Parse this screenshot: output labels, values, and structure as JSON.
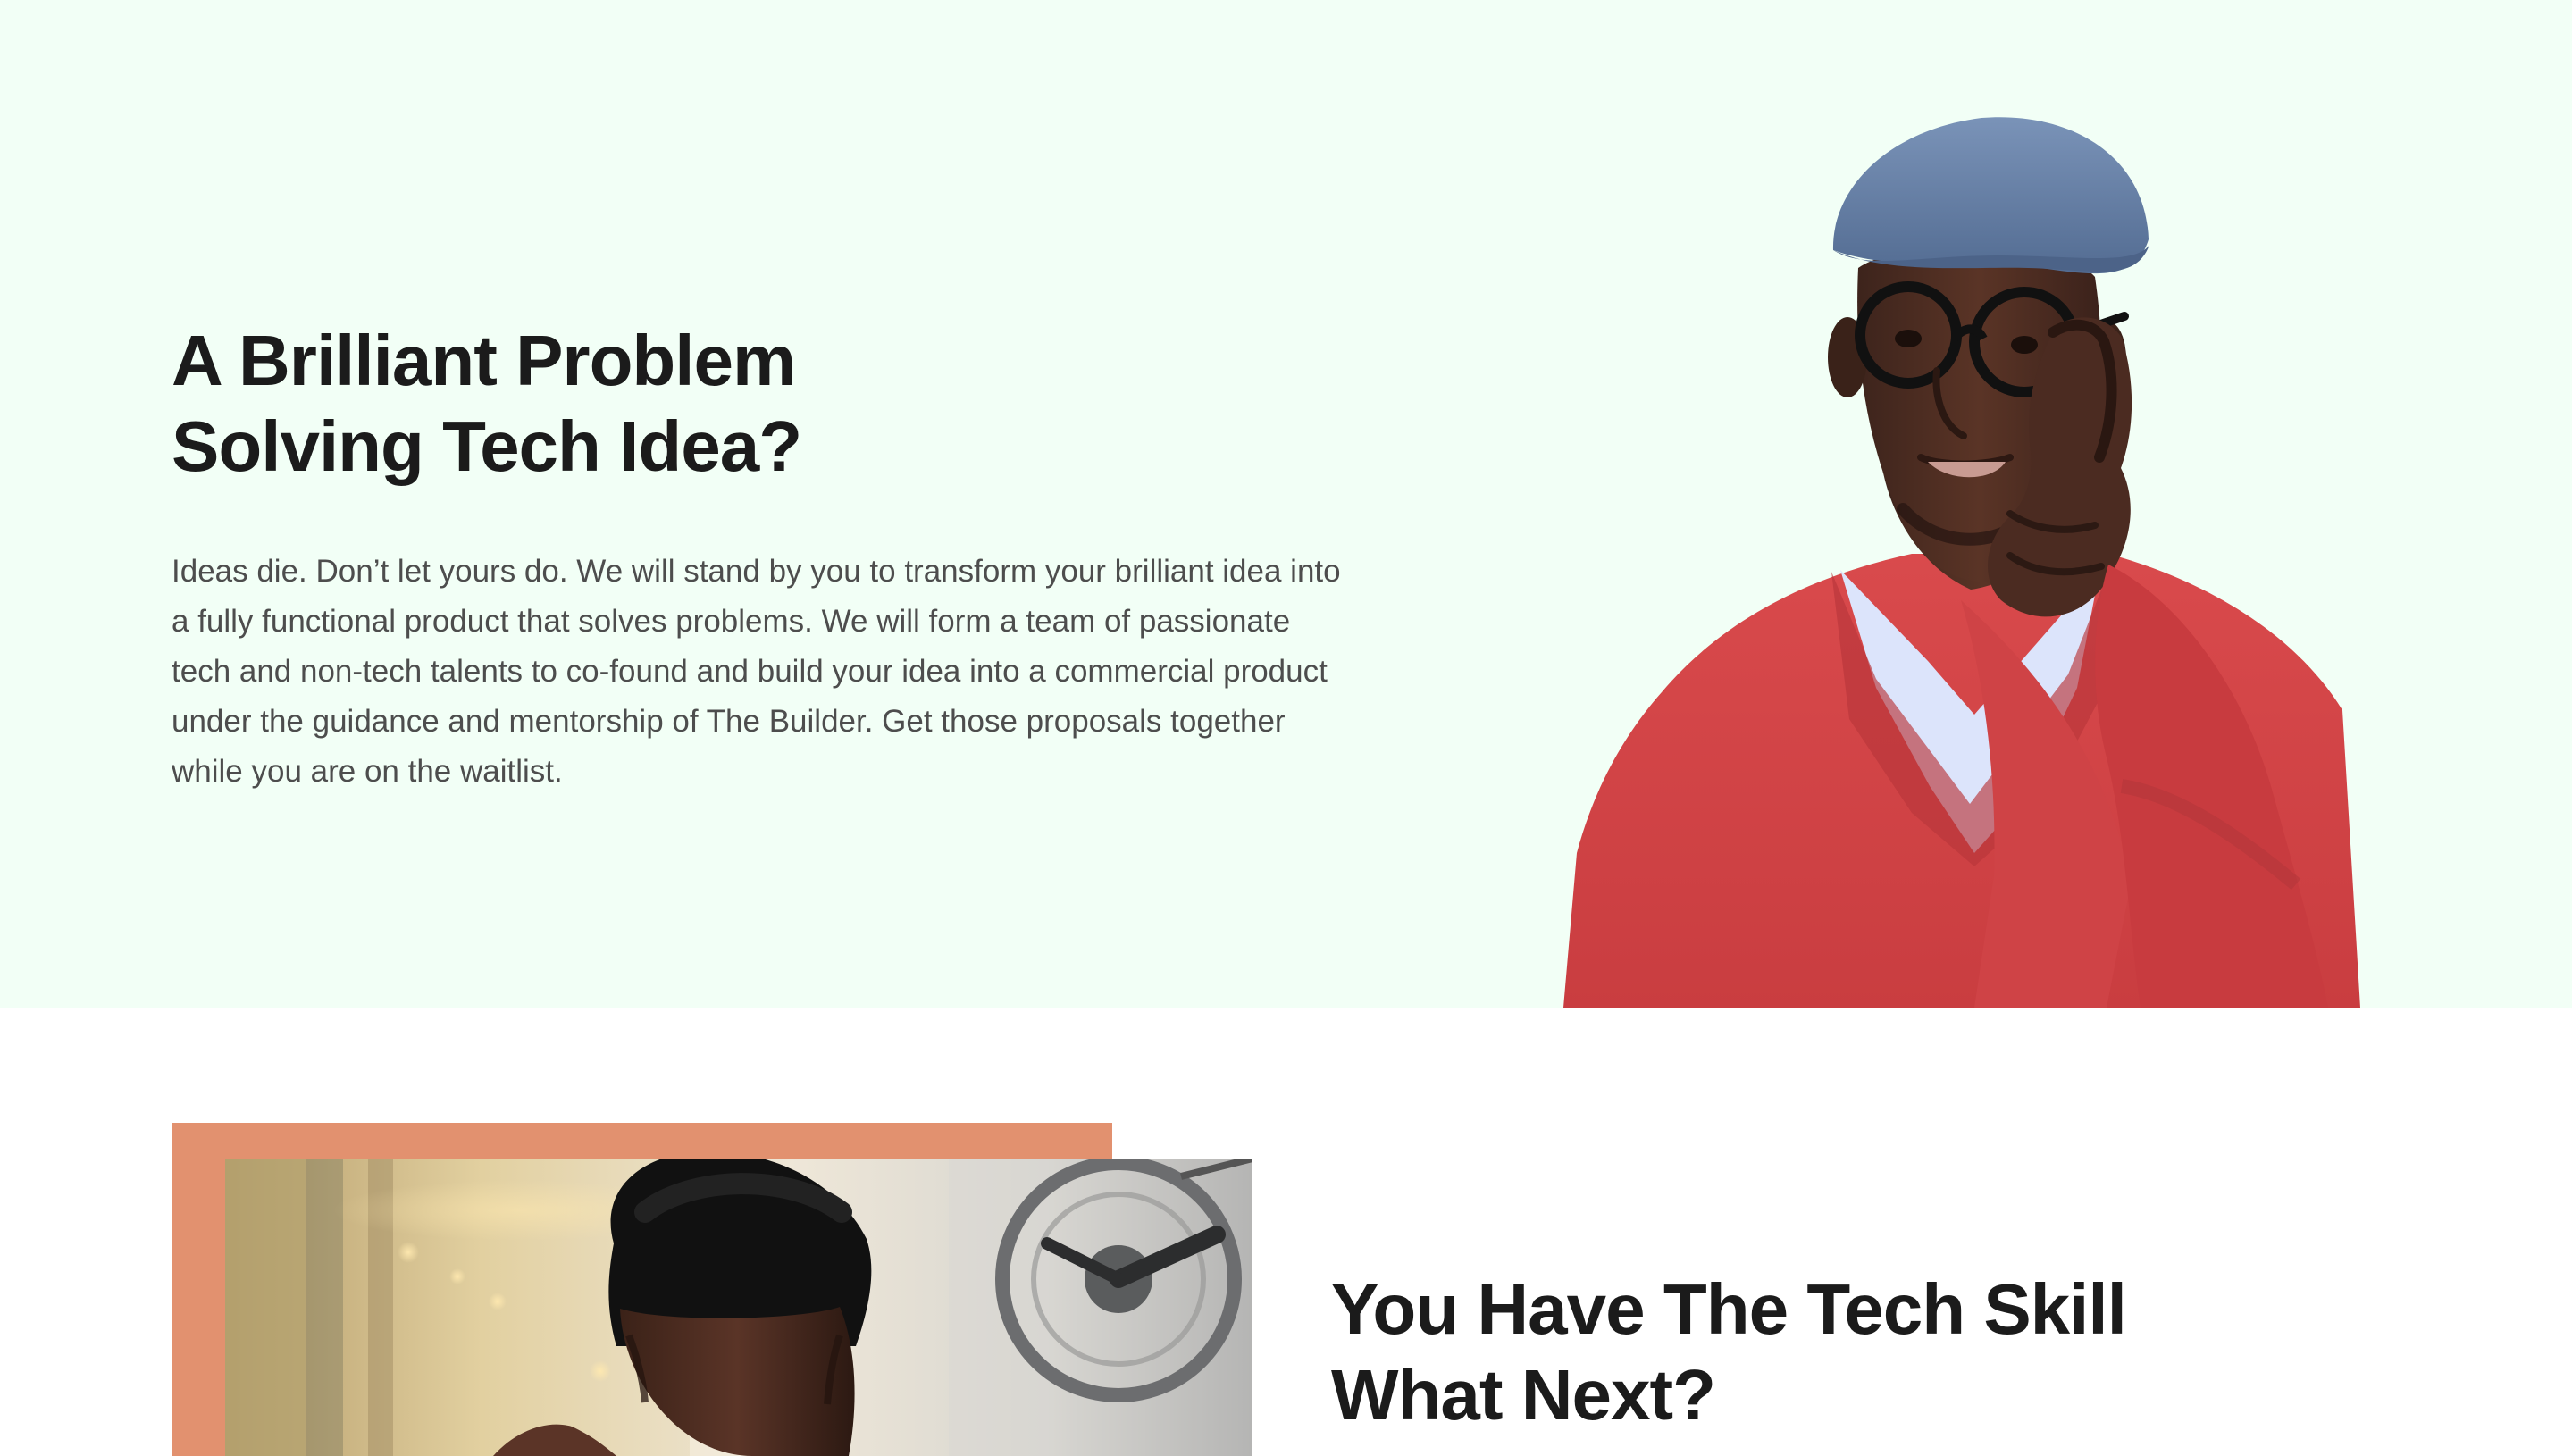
{
  "hero": {
    "title_line_1": "A Brilliant Problem",
    "title_line_2": "Solving Tech Idea?",
    "body": "Ideas die. Don’t let yours do. We will stand by you to transform your brilliant idea into a fully functional product that solves problems. We will form a team of passionate tech and non-tech talents to co-found and build your idea into a commercial product under the guidance and mentorship of The Builder. Get those proposals together while you are on the waitlist.",
    "background_color": "#f2fff6"
  },
  "section_two": {
    "title_line_1": "You Have The Tech Skill",
    "title_line_2": "What Next?",
    "accent_color": "#e2916f"
  },
  "colors": {
    "text_dark": "#1b1b1b",
    "text_body": "#4d4d4d"
  }
}
